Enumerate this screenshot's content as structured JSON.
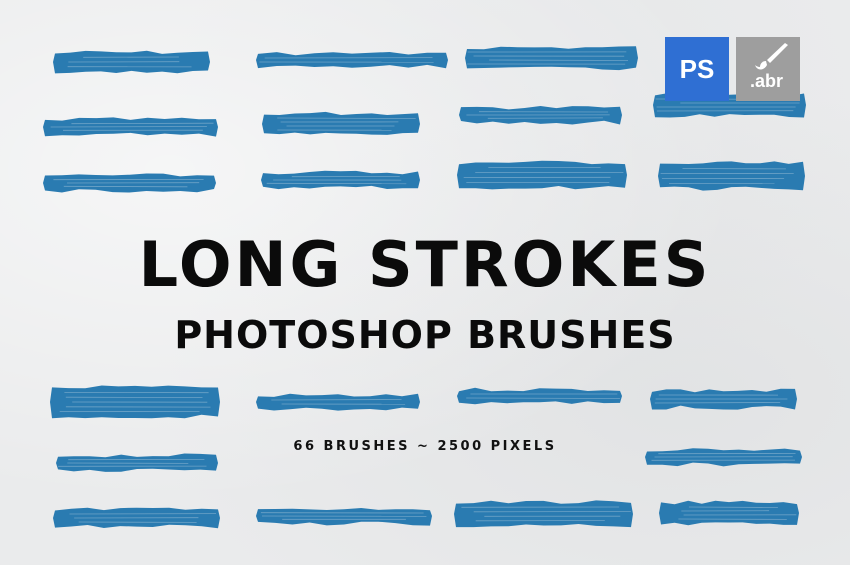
{
  "title": "LONG STROKES",
  "subtitle": "PHOTOSHOP BRUSHES",
  "brush_count_text": "66 BRUSHES ~ 2500 PIXELS",
  "badges": {
    "ps": {
      "label": "PS",
      "color": "#2f6fd3"
    },
    "abr": {
      "label": ".abr",
      "icon": "paintbrush-icon",
      "color": "#9e9e9e"
    }
  },
  "stroke_color": "#2a7bb1"
}
